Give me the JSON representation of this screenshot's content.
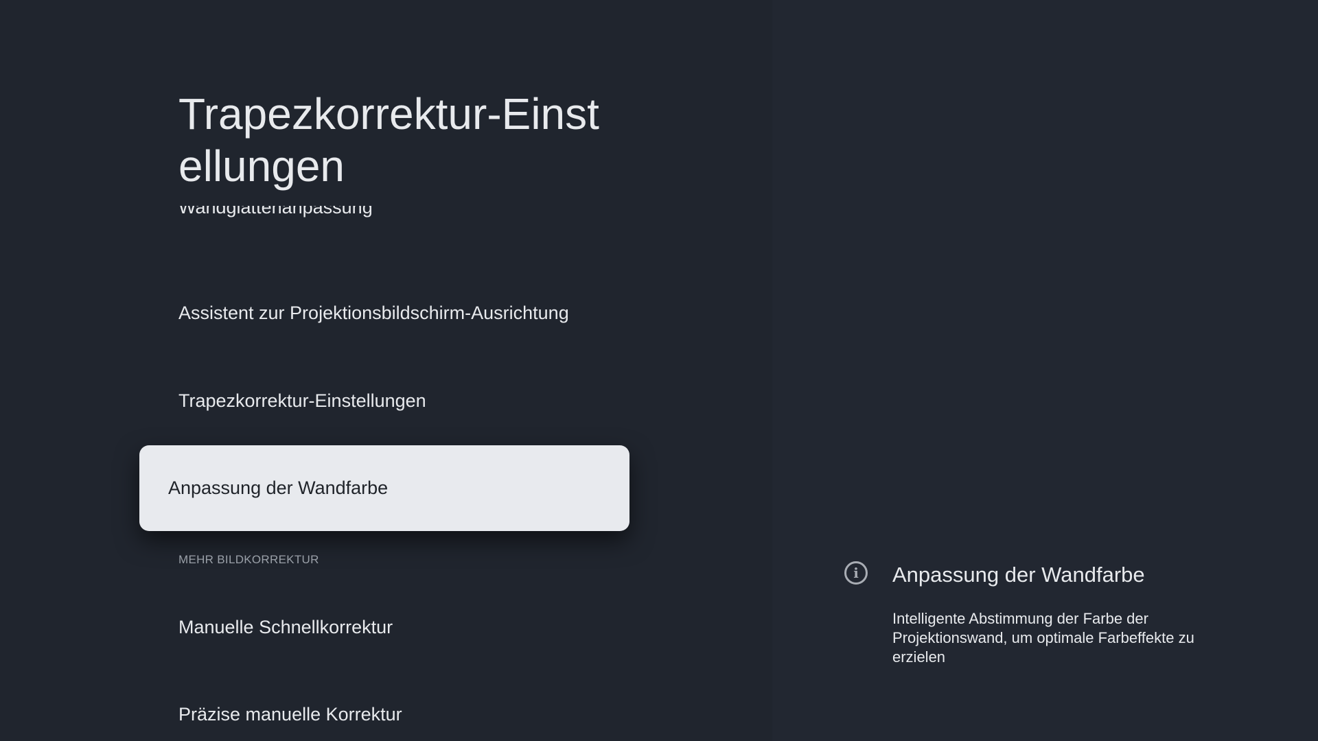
{
  "page": {
    "title": "Trapezkorrektur-Einstellungen"
  },
  "menu": {
    "items": [
      {
        "label": "Wandglättenanpassung"
      },
      {
        "label": "Assistent zur Projektionsbildschirm-Ausrichtung"
      },
      {
        "label": "Trapezkorrektur-Einstellungen"
      },
      {
        "label": "Anpassung der Wandfarbe",
        "focused": true
      }
    ],
    "section_header": "MEHR BILDKORREKTUR",
    "section_items": [
      {
        "label": "Manuelle Schnellkorrektur"
      },
      {
        "label": "Präzise manuelle Korrektur"
      }
    ]
  },
  "info_panel": {
    "icon": "info-icon",
    "title": "Anpassung der Wandfarbe",
    "description": "Intelligente Abstimmung der Farbe der Projektionswand, um optimale Farbeffekte zu erzielen"
  },
  "colors": {
    "background": "#20252e",
    "focused_item_bg": "#e8eaee",
    "text": "#e8eaed",
    "muted_text": "#9aa0a8"
  }
}
